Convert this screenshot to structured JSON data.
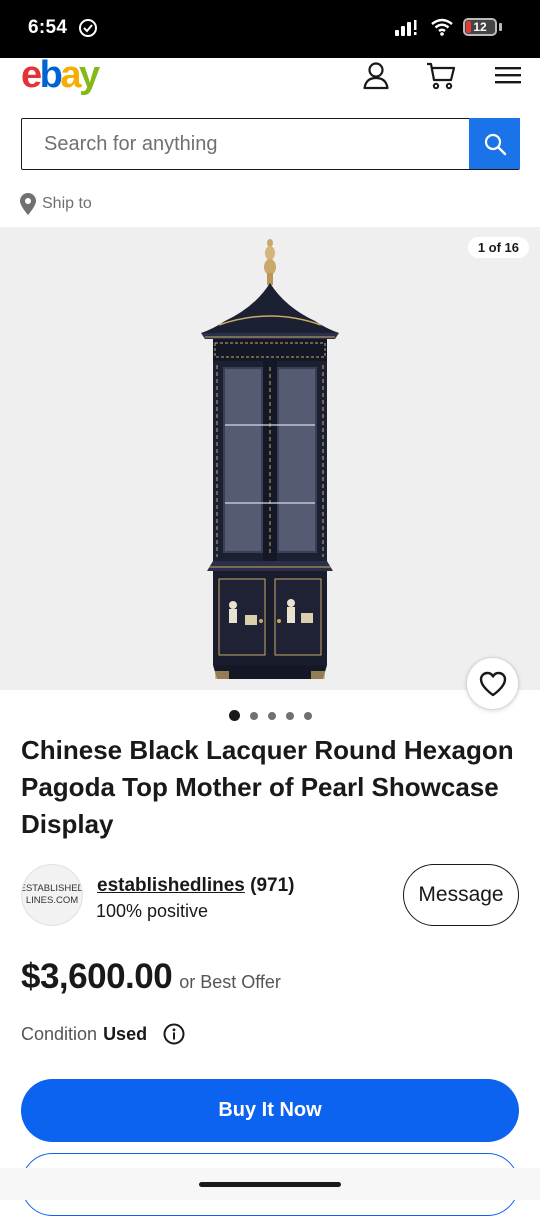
{
  "status_bar": {
    "time": "6:54",
    "battery_level": "12"
  },
  "header": {
    "logo_letters": [
      "e",
      "b",
      "a",
      "y"
    ],
    "logo_colors": [
      "#e53238",
      "#0064d2",
      "#f5af02",
      "#86b817"
    ],
    "icons": [
      "user-icon",
      "cart-icon",
      "menu-icon"
    ]
  },
  "search": {
    "placeholder": "Search for anything",
    "button_color": "#1a73e8"
  },
  "ship_to": {
    "label": "Ship to"
  },
  "gallery": {
    "counter": "1 of 16",
    "image_index": 1,
    "image_total": 16,
    "dots_count": 5,
    "active_dot": 0,
    "background": "#efefef"
  },
  "listing": {
    "title": "Chinese Black Lacquer Round Hexagon Pagoda Top Mother of Pearl Showcase Display",
    "price": "$3,600.00",
    "price_suffix": "or Best Offer",
    "condition_label": "Condition",
    "condition_value": "Used"
  },
  "seller": {
    "avatar_text": "ESTABLISHED LINES.COM",
    "username": "establishedlines",
    "feedback_count": "(971)",
    "positive": "100% positive",
    "message_label": "Message"
  },
  "actions": {
    "buy_now_label": "Buy It Now",
    "primary_color": "#0b63f0"
  }
}
